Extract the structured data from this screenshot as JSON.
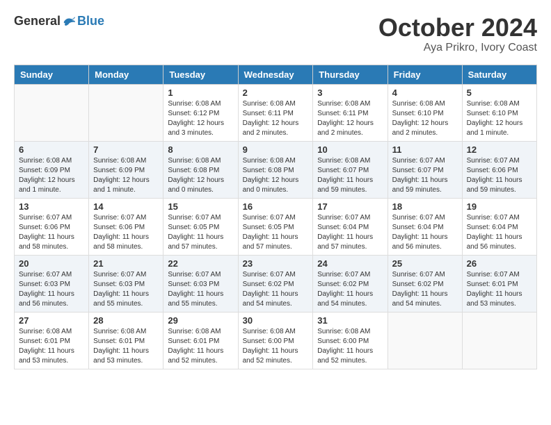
{
  "logo": {
    "general": "General",
    "blue": "Blue"
  },
  "title": "October 2024",
  "subtitle": "Aya Prikro, Ivory Coast",
  "headers": [
    "Sunday",
    "Monday",
    "Tuesday",
    "Wednesday",
    "Thursday",
    "Friday",
    "Saturday"
  ],
  "weeks": [
    [
      {
        "day": "",
        "info": ""
      },
      {
        "day": "",
        "info": ""
      },
      {
        "day": "1",
        "info": "Sunrise: 6:08 AM\nSunset: 6:12 PM\nDaylight: 12 hours\nand 3 minutes."
      },
      {
        "day": "2",
        "info": "Sunrise: 6:08 AM\nSunset: 6:11 PM\nDaylight: 12 hours\nand 2 minutes."
      },
      {
        "day": "3",
        "info": "Sunrise: 6:08 AM\nSunset: 6:11 PM\nDaylight: 12 hours\nand 2 minutes."
      },
      {
        "day": "4",
        "info": "Sunrise: 6:08 AM\nSunset: 6:10 PM\nDaylight: 12 hours\nand 2 minutes."
      },
      {
        "day": "5",
        "info": "Sunrise: 6:08 AM\nSunset: 6:10 PM\nDaylight: 12 hours\nand 1 minute."
      }
    ],
    [
      {
        "day": "6",
        "info": "Sunrise: 6:08 AM\nSunset: 6:09 PM\nDaylight: 12 hours\nand 1 minute."
      },
      {
        "day": "7",
        "info": "Sunrise: 6:08 AM\nSunset: 6:09 PM\nDaylight: 12 hours\nand 1 minute."
      },
      {
        "day": "8",
        "info": "Sunrise: 6:08 AM\nSunset: 6:08 PM\nDaylight: 12 hours\nand 0 minutes."
      },
      {
        "day": "9",
        "info": "Sunrise: 6:08 AM\nSunset: 6:08 PM\nDaylight: 12 hours\nand 0 minutes."
      },
      {
        "day": "10",
        "info": "Sunrise: 6:08 AM\nSunset: 6:07 PM\nDaylight: 11 hours\nand 59 minutes."
      },
      {
        "day": "11",
        "info": "Sunrise: 6:07 AM\nSunset: 6:07 PM\nDaylight: 11 hours\nand 59 minutes."
      },
      {
        "day": "12",
        "info": "Sunrise: 6:07 AM\nSunset: 6:06 PM\nDaylight: 11 hours\nand 59 minutes."
      }
    ],
    [
      {
        "day": "13",
        "info": "Sunrise: 6:07 AM\nSunset: 6:06 PM\nDaylight: 11 hours\nand 58 minutes."
      },
      {
        "day": "14",
        "info": "Sunrise: 6:07 AM\nSunset: 6:06 PM\nDaylight: 11 hours\nand 58 minutes."
      },
      {
        "day": "15",
        "info": "Sunrise: 6:07 AM\nSunset: 6:05 PM\nDaylight: 11 hours\nand 57 minutes."
      },
      {
        "day": "16",
        "info": "Sunrise: 6:07 AM\nSunset: 6:05 PM\nDaylight: 11 hours\nand 57 minutes."
      },
      {
        "day": "17",
        "info": "Sunrise: 6:07 AM\nSunset: 6:04 PM\nDaylight: 11 hours\nand 57 minutes."
      },
      {
        "day": "18",
        "info": "Sunrise: 6:07 AM\nSunset: 6:04 PM\nDaylight: 11 hours\nand 56 minutes."
      },
      {
        "day": "19",
        "info": "Sunrise: 6:07 AM\nSunset: 6:04 PM\nDaylight: 11 hours\nand 56 minutes."
      }
    ],
    [
      {
        "day": "20",
        "info": "Sunrise: 6:07 AM\nSunset: 6:03 PM\nDaylight: 11 hours\nand 56 minutes."
      },
      {
        "day": "21",
        "info": "Sunrise: 6:07 AM\nSunset: 6:03 PM\nDaylight: 11 hours\nand 55 minutes."
      },
      {
        "day": "22",
        "info": "Sunrise: 6:07 AM\nSunset: 6:03 PM\nDaylight: 11 hours\nand 55 minutes."
      },
      {
        "day": "23",
        "info": "Sunrise: 6:07 AM\nSunset: 6:02 PM\nDaylight: 11 hours\nand 54 minutes."
      },
      {
        "day": "24",
        "info": "Sunrise: 6:07 AM\nSunset: 6:02 PM\nDaylight: 11 hours\nand 54 minutes."
      },
      {
        "day": "25",
        "info": "Sunrise: 6:07 AM\nSunset: 6:02 PM\nDaylight: 11 hours\nand 54 minutes."
      },
      {
        "day": "26",
        "info": "Sunrise: 6:07 AM\nSunset: 6:01 PM\nDaylight: 11 hours\nand 53 minutes."
      }
    ],
    [
      {
        "day": "27",
        "info": "Sunrise: 6:08 AM\nSunset: 6:01 PM\nDaylight: 11 hours\nand 53 minutes."
      },
      {
        "day": "28",
        "info": "Sunrise: 6:08 AM\nSunset: 6:01 PM\nDaylight: 11 hours\nand 53 minutes."
      },
      {
        "day": "29",
        "info": "Sunrise: 6:08 AM\nSunset: 6:01 PM\nDaylight: 11 hours\nand 52 minutes."
      },
      {
        "day": "30",
        "info": "Sunrise: 6:08 AM\nSunset: 6:00 PM\nDaylight: 11 hours\nand 52 minutes."
      },
      {
        "day": "31",
        "info": "Sunrise: 6:08 AM\nSunset: 6:00 PM\nDaylight: 11 hours\nand 52 minutes."
      },
      {
        "day": "",
        "info": ""
      },
      {
        "day": "",
        "info": ""
      }
    ]
  ]
}
